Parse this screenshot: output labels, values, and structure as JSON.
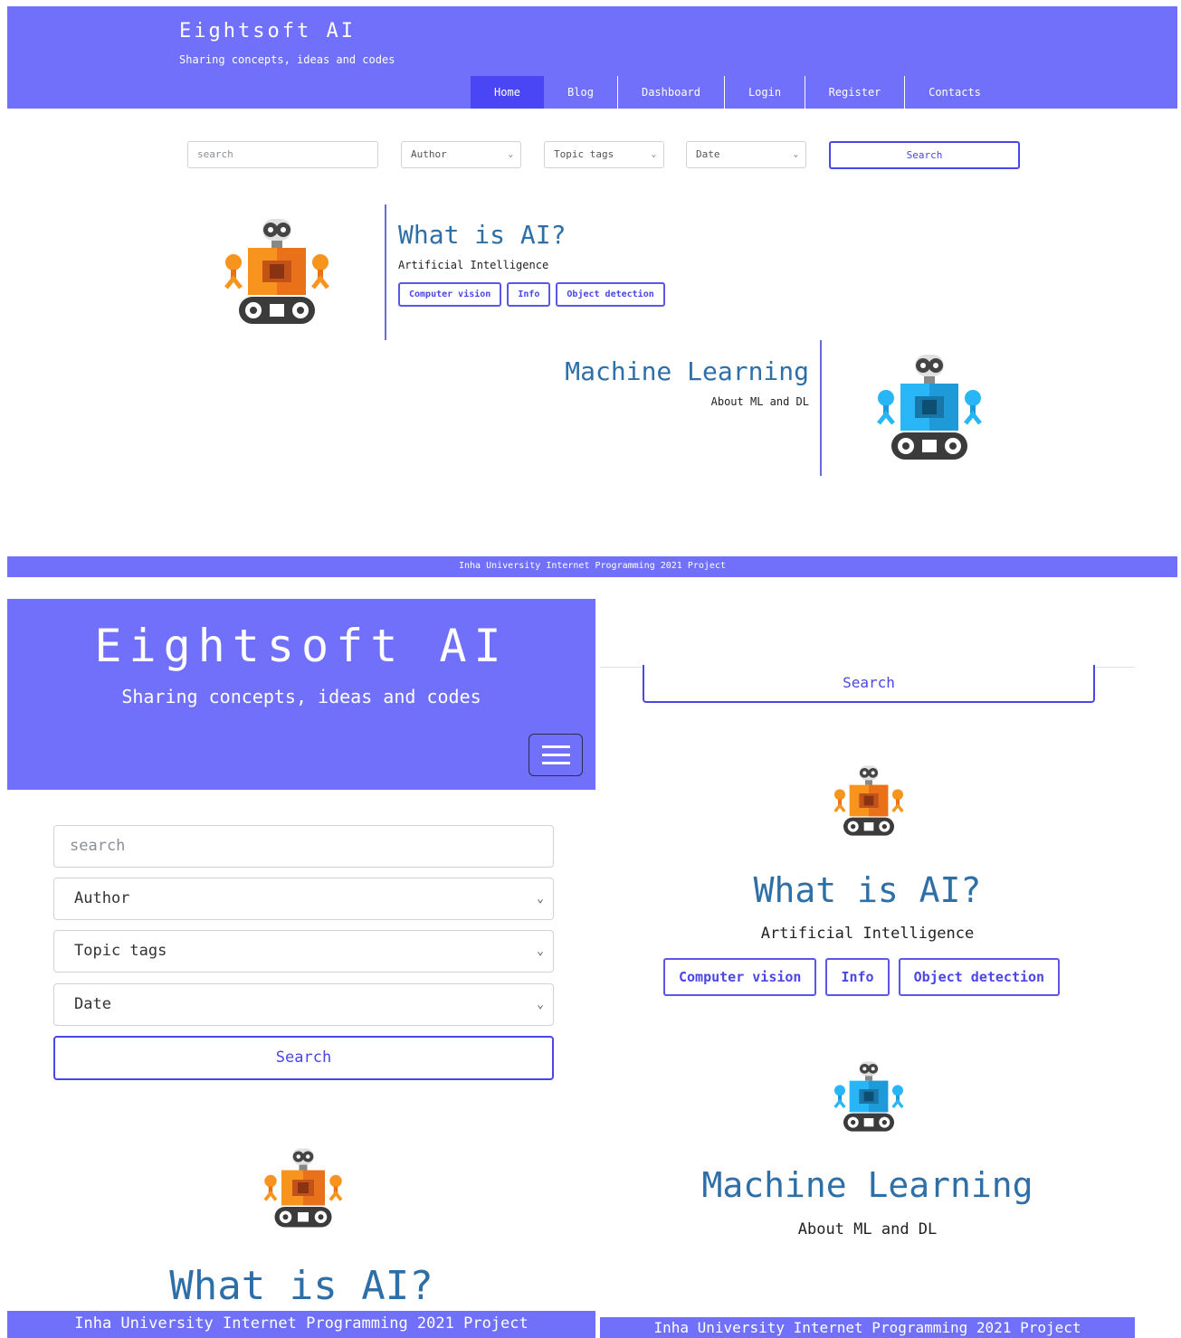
{
  "brand": {
    "title": "Eightsoft AI",
    "tagline": "Sharing concepts, ideas and codes"
  },
  "nav": [
    {
      "label": "Home",
      "active": true
    },
    {
      "label": "Blog",
      "active": false
    },
    {
      "label": "Dashboard",
      "active": false
    },
    {
      "label": "Login",
      "active": false
    },
    {
      "label": "Register",
      "active": false
    },
    {
      "label": "Contacts",
      "active": false
    }
  ],
  "filters": {
    "search_placeholder": "search",
    "author": "Author",
    "topic_tags": "Topic tags",
    "date": "Date",
    "search_button": "Search"
  },
  "posts": [
    {
      "title": "What is AI?",
      "subtitle": "Artificial Intelligence",
      "tags": [
        "Computer vision",
        "Info",
        "Object detection"
      ],
      "robot_color": "orange"
    },
    {
      "title": "Machine Learning",
      "subtitle": "About ML and DL",
      "tags": [],
      "robot_color": "blue"
    }
  ],
  "footer": {
    "text": "Inha University Internet Programming 2021 Project"
  },
  "colors": {
    "header_bg": "#7070fb",
    "active_nav": "#4a46f5",
    "accent": "#4a46e8",
    "post_title": "#2f6fa7",
    "robot_orange": "#f7941d",
    "robot_blue": "#1ea7e8"
  }
}
